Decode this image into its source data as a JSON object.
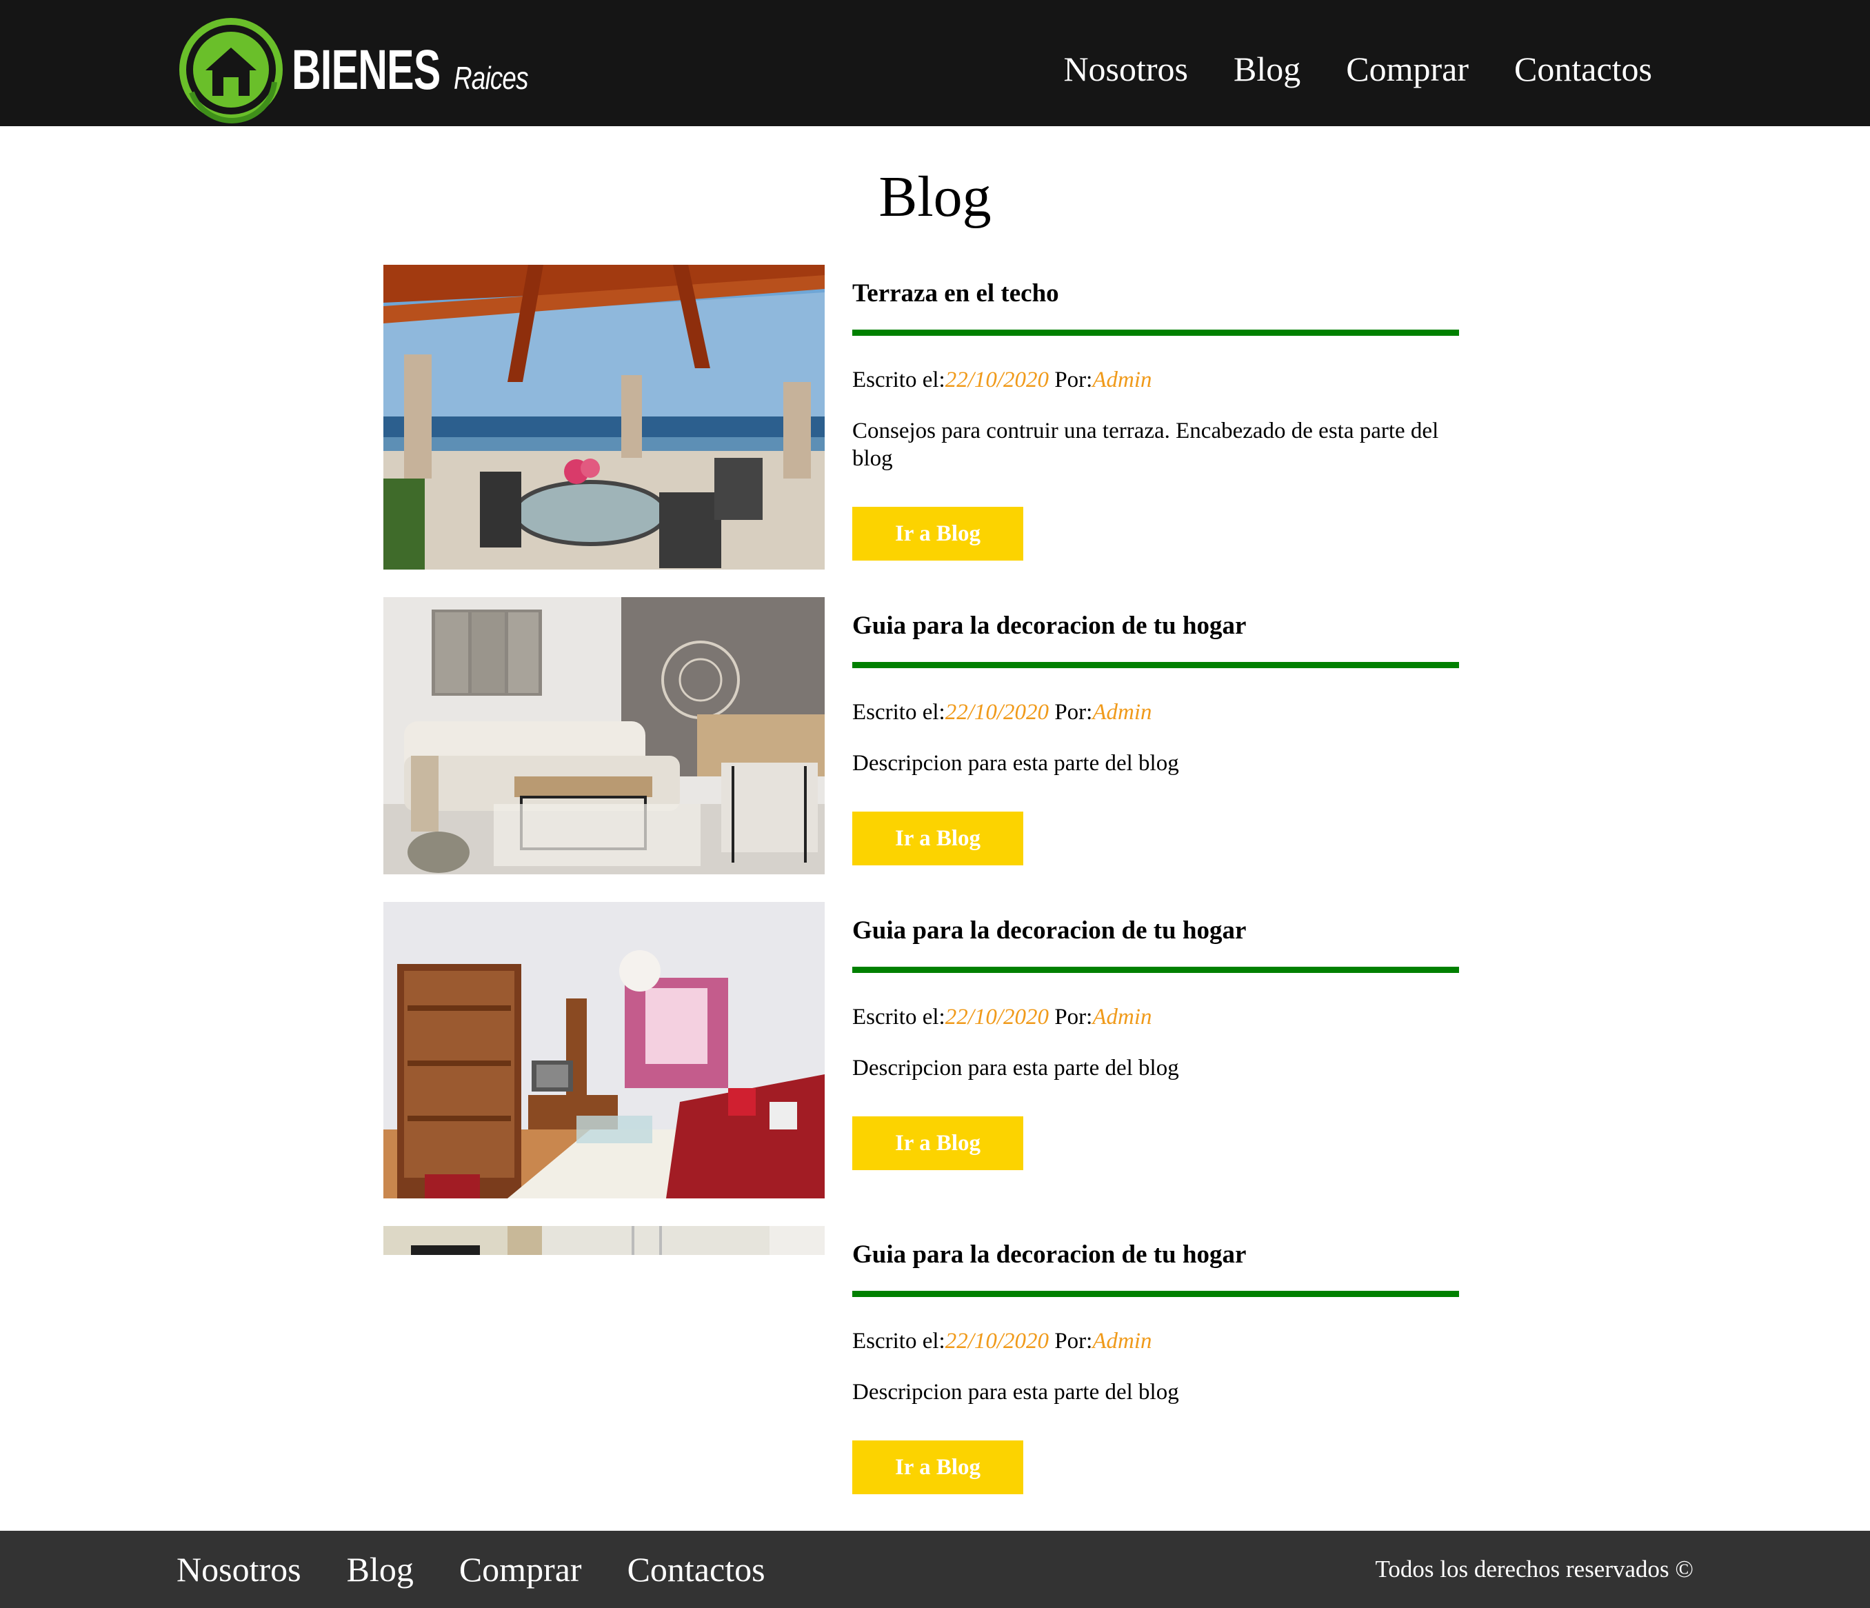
{
  "header": {
    "logo": {
      "main": "BIENES",
      "sub": "Raices"
    },
    "nav": [
      "Nosotros",
      "Blog",
      "Comprar",
      "Contactos"
    ]
  },
  "main": {
    "title": "Blog",
    "entries": [
      {
        "title": "Terraza en el techo",
        "written_label": "Escrito el:",
        "date": "22/10/2020",
        "by_label": "Por:",
        "author": "Admin",
        "description": "Consejos para contruir una terraza. Encabezado de esta parte del blog",
        "button": "Ir a Blog",
        "image": "rooftop-terrace-photo"
      },
      {
        "title": "Guia para la decoracion de tu hogar",
        "written_label": "Escrito el:",
        "date": "22/10/2020",
        "by_label": "Por:",
        "author": "Admin",
        "description": "Descripcion para esta parte del blog",
        "button": "Ir a Blog",
        "image": "living-room-sofa-photo"
      },
      {
        "title": "Guia para la decoracion de tu hogar",
        "written_label": "Escrito el:",
        "date": "22/10/2020",
        "by_label": "Por:",
        "author": "Admin",
        "description": "Descripcion para esta parte del blog",
        "button": "Ir a Blog",
        "image": "living-room-red-sofa-photo"
      },
      {
        "title": "Guia para la decoracion de tu hogar",
        "written_label": "Escrito el:",
        "date": "22/10/2020",
        "by_label": "Por:",
        "author": "Admin",
        "description": "Descripcion para esta parte del blog",
        "button": "Ir a Blog",
        "image": "partially-loaded-room-photo"
      }
    ]
  },
  "footer": {
    "nav": [
      "Nosotros",
      "Blog",
      "Comprar",
      "Contactos"
    ],
    "copyright": "Todos los derechos reservados ©"
  },
  "colors": {
    "header_bg": "#151515",
    "footer_bg": "#333333",
    "accent_green": "#008000",
    "logo_green": "#6abf2a",
    "meta_orange": "#f09a1a",
    "button_yellow": "#fcd300"
  }
}
